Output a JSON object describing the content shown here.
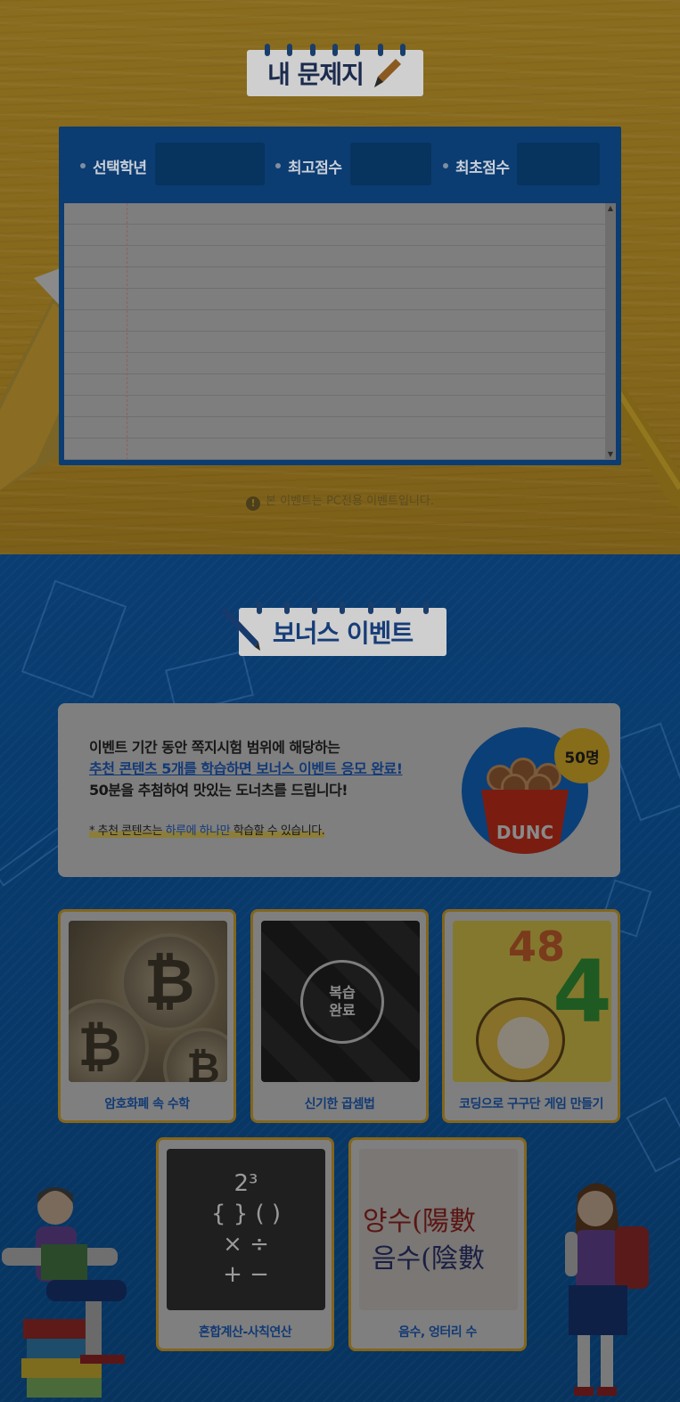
{
  "my_quiz": {
    "title": "내 문제지",
    "filters": [
      {
        "label": "선택학년",
        "value": ""
      },
      {
        "label": "최고점수",
        "value": ""
      },
      {
        "label": "최초점수",
        "value": ""
      }
    ],
    "notice": "본 이벤트는 PC전용 이벤트입니다."
  },
  "bonus": {
    "title": "보너스 이벤트",
    "line1": "이벤트 기간 동안 쪽지시험 범위에 해당하는",
    "line2": "추천 콘텐츠 5개를 학습하면 보너스 이벤트 응모 완료!",
    "line3": "50분을 추첨하여 맛있는 도너츠를 드립니다!",
    "sub_prefix": "* 추천 콘텐츠는 ",
    "sub_highlight": "하루에 하나만",
    "sub_suffix": " 학습할 수 있습니다.",
    "badge": "50명",
    "cup_text": "DUNC"
  },
  "contents": [
    {
      "label": "암호화폐 속 수학",
      "icon": "bitcoin-icon"
    },
    {
      "label": "신기한 곱셈법",
      "status": "복습\n완료",
      "icon": "review-complete-icon"
    },
    {
      "label": "코딩으로 구구단 게임 만들기",
      "icon": "cartoon-icon",
      "overlay": [
        "48",
        "4"
      ]
    },
    {
      "label": "혼합계산-사칙연산",
      "icon": "math-symbols-icon",
      "overlay": [
        "2³",
        "{ } ( )",
        "× ÷",
        "+ −"
      ]
    },
    {
      "label": "음수, 엉터리 수",
      "icon": "hanja-icon",
      "overlay": [
        "양수(陽數",
        "음수(陰數"
      ]
    }
  ],
  "colors": {
    "wood": "#86681c",
    "notebook": "#0b3c72",
    "blue_bg": "#083a6c",
    "card_border": "#84651b",
    "label_text": "#123a74"
  }
}
